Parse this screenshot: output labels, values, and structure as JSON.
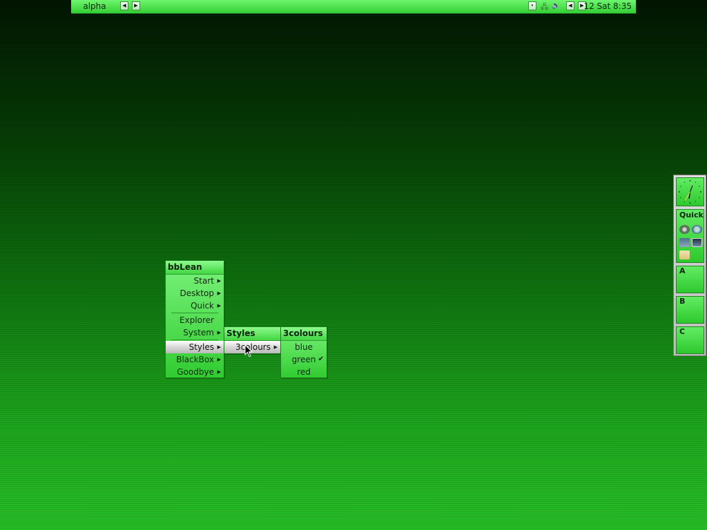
{
  "toolbar": {
    "workspace": "alpha",
    "prev_icon": "triangle-left-icon",
    "next_icon": "triangle-right-icon",
    "clock": "12 Sat 8:35"
  },
  "menu_main": {
    "title": "bbLean",
    "items": {
      "start": "Start",
      "desktop": "Desktop",
      "quick": "Quick",
      "explorer": "Explorer",
      "system": "System",
      "styles": "Styles",
      "blackbox": "BlackBox",
      "goodbye": "Goodbye"
    }
  },
  "menu_styles": {
    "title": "Styles",
    "items": {
      "threecolours": "3colours"
    }
  },
  "menu_3colours": {
    "title": "3colours",
    "items": {
      "blue": "blue",
      "green": "green",
      "red": "red"
    },
    "selected": "green"
  },
  "slit": {
    "quick_label": "Quick",
    "workspaces": [
      "A",
      "B",
      "C"
    ]
  },
  "colors": {
    "menu_green": "#31cc31",
    "highlight": "#d8d8d8",
    "desktop_top": "#021502",
    "desktop_bottom": "#27be27"
  }
}
